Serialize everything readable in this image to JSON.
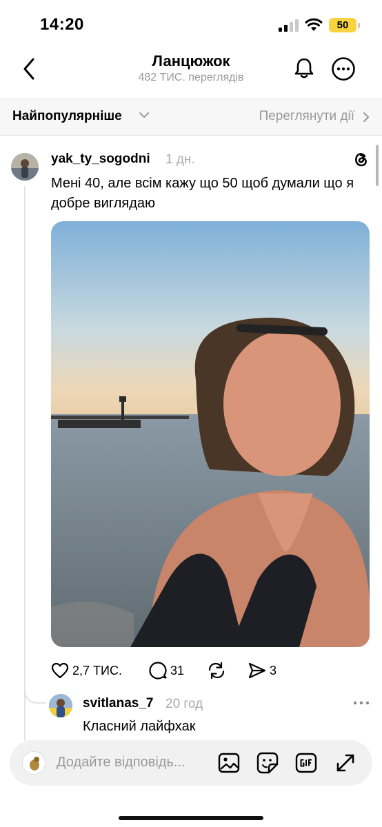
{
  "status_bar": {
    "time": "14:20",
    "battery": "50"
  },
  "header": {
    "title": "Ланцюжок",
    "subtitle": "482 ТИС. переглядів"
  },
  "sort_bar": {
    "sort_label": "Найпопулярніше",
    "view_actions_label": "Переглянути дії"
  },
  "post": {
    "username": "yak_ty_sogodni",
    "time": "1 дн.",
    "text": "Мені 40, але всім кажу що 50 щоб думали що я добре виглядаю",
    "likes": "2,7 ТИС.",
    "comments": "31",
    "shares": "3"
  },
  "reply": {
    "username": "svitlanas_7",
    "time": "20 год",
    "text": "Класний лайфхак"
  },
  "composer": {
    "placeholder": "Додайте відповідь..."
  },
  "icons": {
    "back": "chevron-left-icon",
    "bell": "bell-icon",
    "more": "more-circle-icon",
    "threads": "threads-logo-icon",
    "like": "heart-icon",
    "comment": "comment-icon",
    "repost": "repost-icon",
    "share": "send-icon",
    "image": "image-icon",
    "sticker": "sticker-icon",
    "gif": "gif-icon",
    "expand": "expand-icon"
  },
  "colors": {
    "battery": "#f7d33f",
    "muted": "#999999",
    "composer_bg": "#f1f1f1"
  }
}
